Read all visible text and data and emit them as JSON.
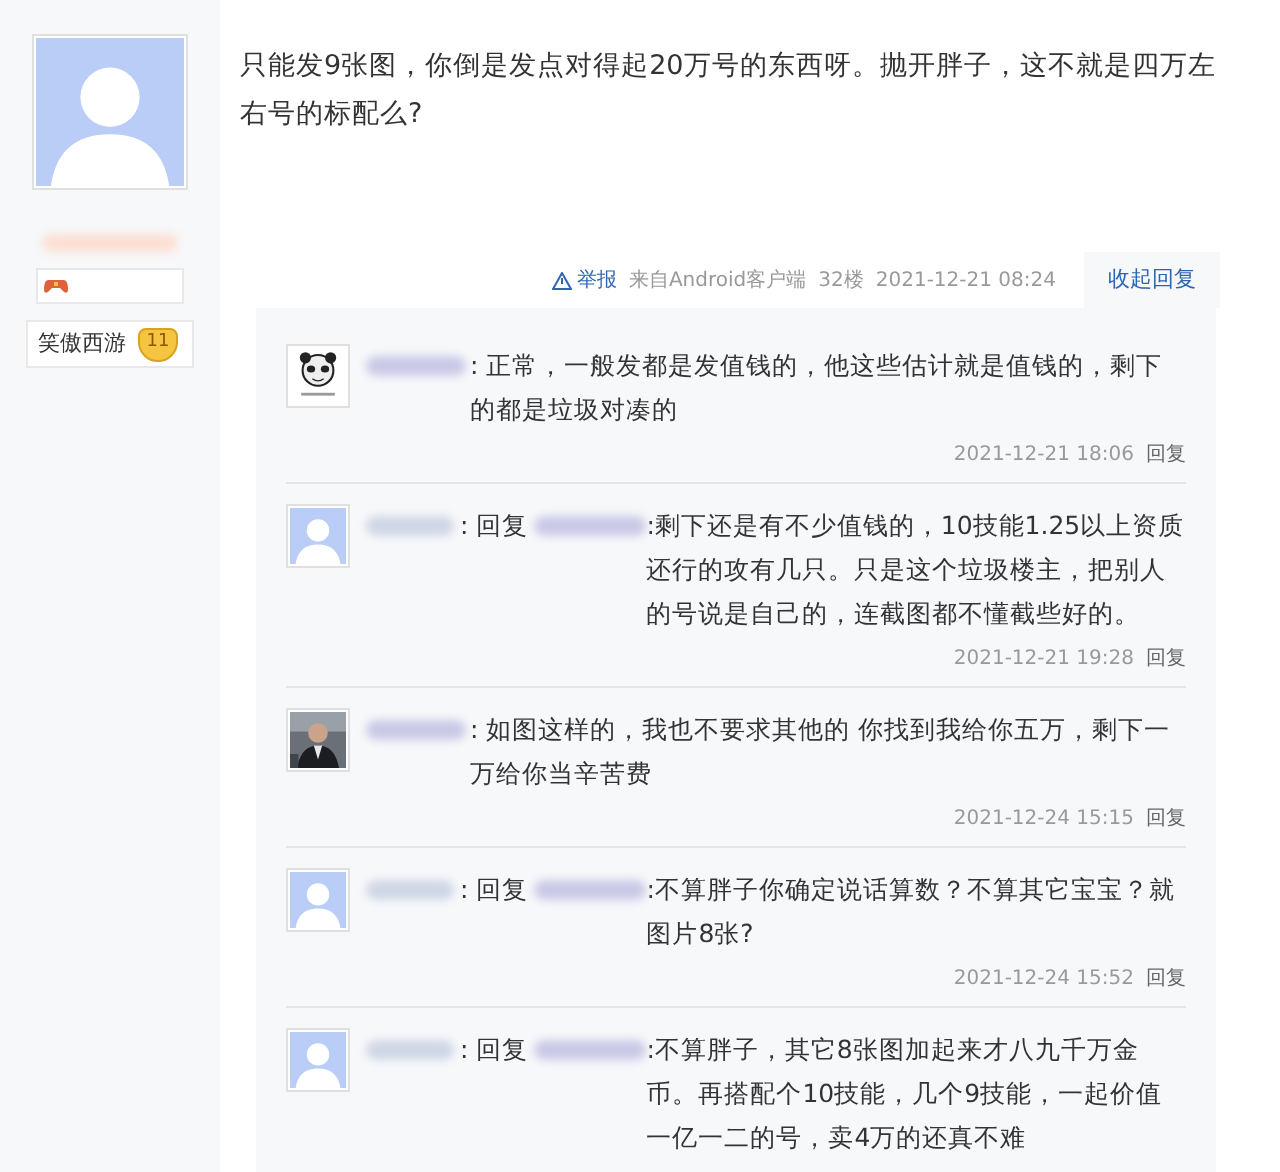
{
  "author": {
    "avatar": {
      "kind": "default"
    },
    "tag": "笑傲西游",
    "level": "11"
  },
  "post": {
    "text": "只能发9张图，你倒是发点对得起20万号的东西呀。抛开胖子，这不就是四万左右号的标配么?"
  },
  "post_meta": {
    "report": "举报",
    "source": "来自Android客户端",
    "floor": "32楼",
    "time": "2021-12-21 08:24",
    "toggle": "收起回复"
  },
  "replies": [
    {
      "avatar": {
        "kind": "panda"
      },
      "text": ": 正常，一般发都是发值钱的，他这些估计就是值钱的，剩下的都是垃圾对凑的",
      "time": "2021-12-21 18:06",
      "reply": "回复"
    },
    {
      "avatar": {
        "kind": "default"
      },
      "reply_label": ": 回复",
      "text": ":剩下还是有不少值钱的，10技能1.25以上资质还行的攻有几只。只是这个垃圾楼主，把别人的号说是自己的，连截图都不懂截些好的。",
      "time": "2021-12-21 19:28",
      "reply": "回复"
    },
    {
      "text": ": 如图这样的，我也不要求其他的 你找到我给你五万，剩下一万给你当辛苦费",
      "time": "2021-12-24 15:15",
      "reply": "回复"
    },
    {
      "avatar": {
        "kind": "default"
      },
      "reply_label": ": 回复",
      "text": ":不算胖子你确定说话算数？不算其它宝宝？就图片8张?",
      "time": "2021-12-24 15:52",
      "reply": "回复"
    },
    {
      "avatar": {
        "kind": "default"
      },
      "reply_label": ": 回复",
      "text": ":不算胖子，其它8张图加起来才八九千万金币。再搭配个10技能，几个9技能，一起价值一亿一二的号，卖4万的还真不难"
    }
  ]
}
